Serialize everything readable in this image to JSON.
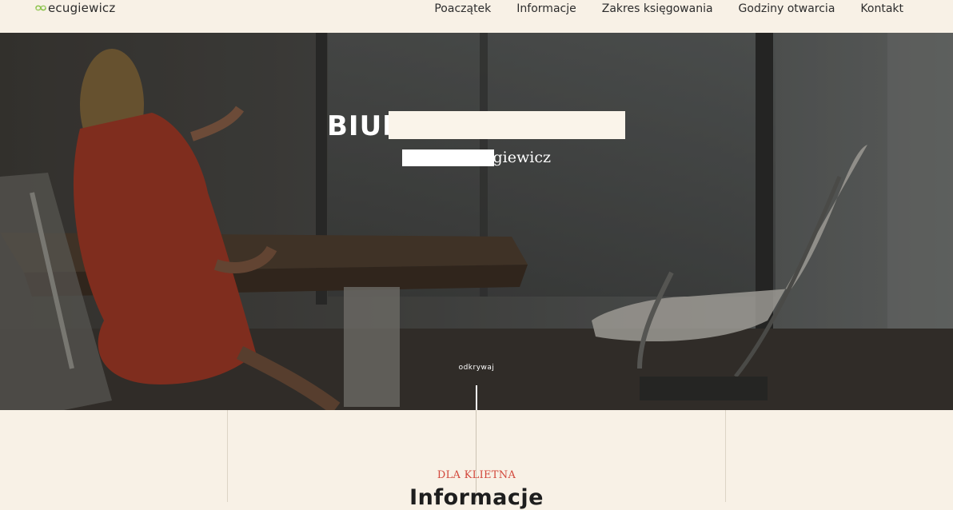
{
  "header": {
    "logo_text": "ecugiewicz",
    "logo_icon": "infinity-logo-icon",
    "nav": [
      {
        "label": "Poaczątek"
      },
      {
        "label": "Informacje"
      },
      {
        "label": "Zakres księgowania"
      },
      {
        "label": "Godziny otwarcia"
      },
      {
        "label": "Kontakt"
      }
    ]
  },
  "hero": {
    "title": "BIURO",
    "subtitle": "ugiewicz",
    "scroll_label": "odkrywaj"
  },
  "section": {
    "kicker": "DLA KLIETNA",
    "title": "Informacje"
  },
  "colors": {
    "background": "#f8f1e6",
    "accent": "#d2473b",
    "logo_accent": "#8bc34a"
  }
}
